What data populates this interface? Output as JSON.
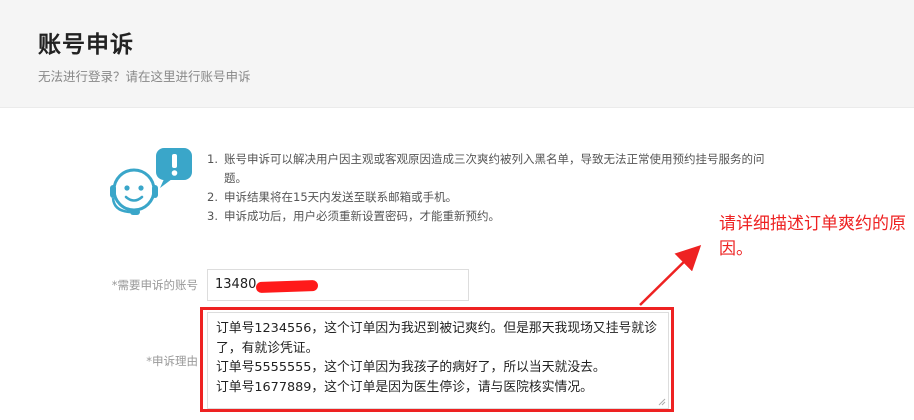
{
  "header": {
    "title": "账号申诉",
    "subtitle": "无法进行登录？请在这里进行账号申诉"
  },
  "notes": [
    {
      "num": "1.",
      "text": "账号申诉可以解决用户因主观或客观原因造成三次爽约被列入黑名单，导致无法正常使用预约挂号服务的问题。"
    },
    {
      "num": "2.",
      "text": "申诉结果将在15天内发送至联系邮箱或手机。"
    },
    {
      "num": "3.",
      "text": "申诉成功后，用户必须重新设置密码，才能重新预约。"
    }
  ],
  "form": {
    "account_label": "*需要申诉的账号",
    "account_value": "13480",
    "reason_label": "*申诉理由",
    "reason_value": "订单号1234556，这个订单因为我迟到被记爽约。但是那天我现场又挂号就诊了，有就诊凭证。\n订单号5555555，这个订单因为我孩子的病好了，所以当天就没去。\n订单号1677889，这个订单是因为医生停诊，请与医院核实情况。"
  },
  "annotation": {
    "text": "请详细描述订单爽约的原因。",
    "color": "#ee2222"
  },
  "icons": {
    "illustration": "customer-service-headset-icon",
    "alert": "exclamation-bubble-icon"
  },
  "colors": {
    "accent": "#3aa6c9",
    "annotation_red": "#ee2222"
  }
}
